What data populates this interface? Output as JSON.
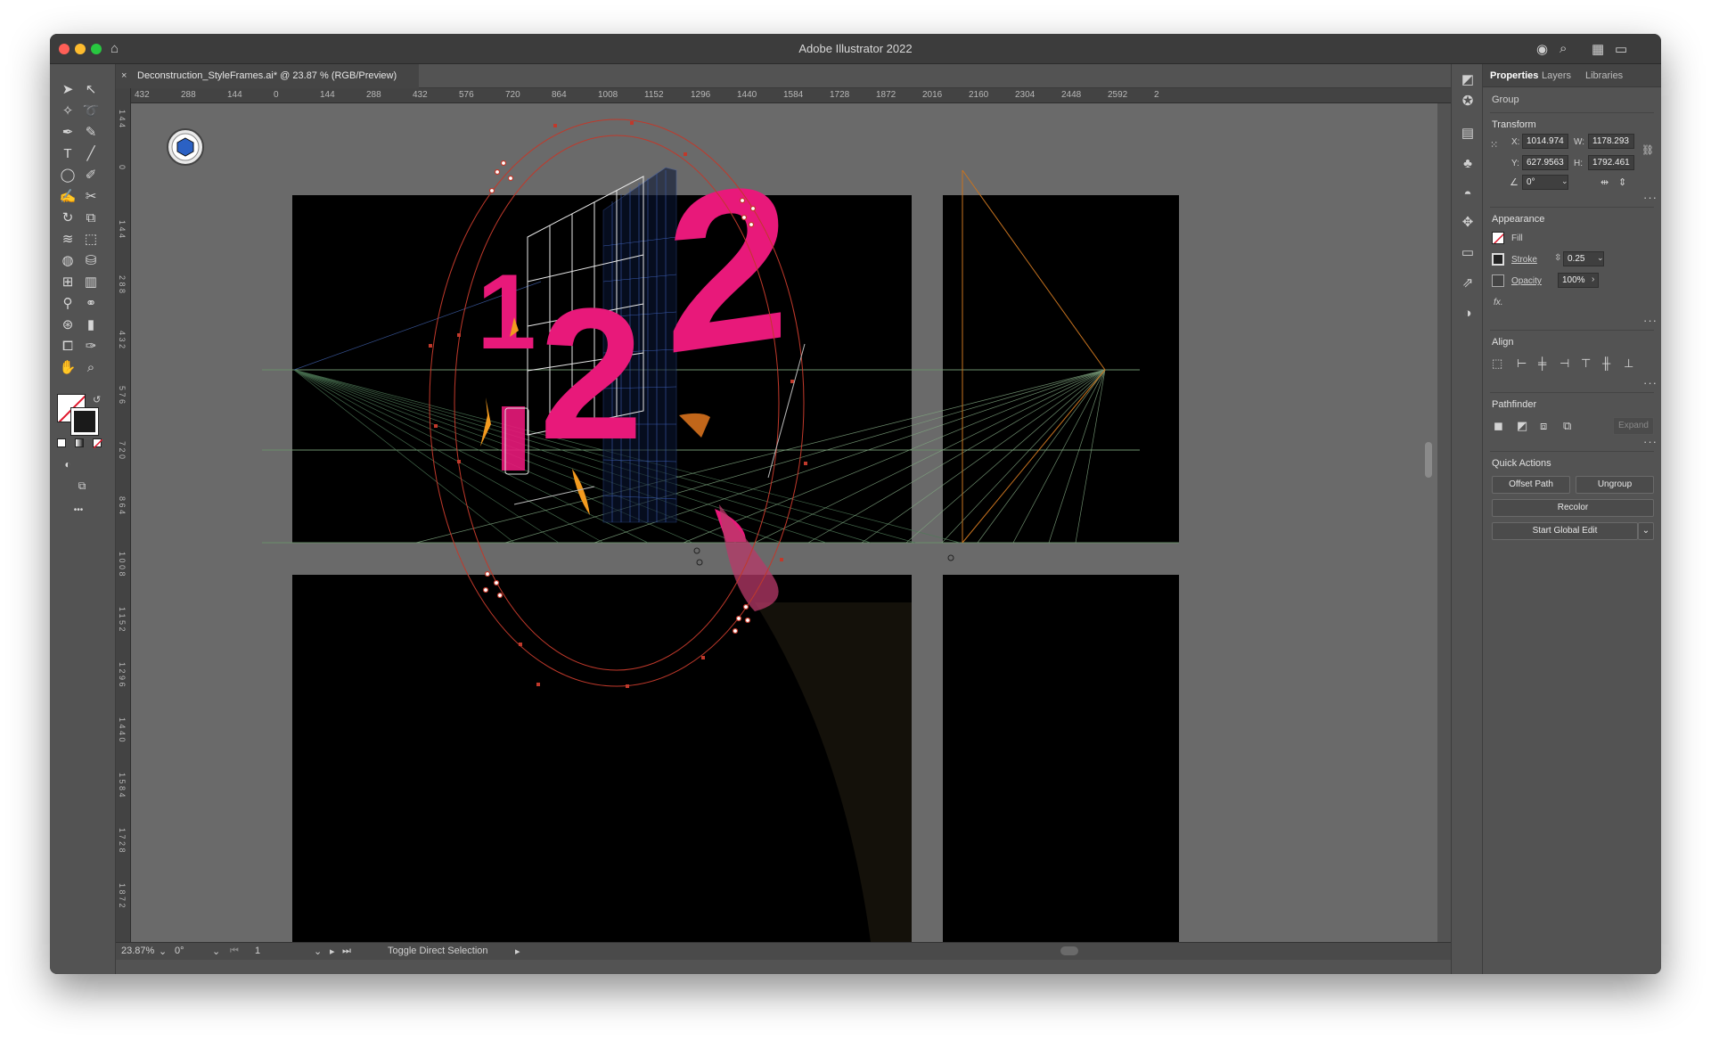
{
  "app": {
    "title": "Adobe Illustrator 2022"
  },
  "document": {
    "tab_title": "Deconstruction_StyleFrames.ai* @ 23.87 % (RGB/Preview)",
    "close_glyph": "×"
  },
  "ruler": {
    "h_ticks": [
      "432",
      "288",
      "144",
      "0",
      "144",
      "288",
      "432",
      "576",
      "720",
      "864",
      "1008",
      "1152",
      "1296",
      "1440",
      "1584",
      "1728",
      "1872",
      "2016",
      "2160",
      "2304",
      "2448",
      "2592",
      "2"
    ],
    "v_ticks": [
      "1 4 4",
      "0",
      "1 4 4",
      "2 8 8",
      "4 3 2",
      "5 7 6",
      "7 2 0",
      "8 6 4",
      "1 0 0 8",
      "1 1 5 2",
      "1 2 9 6",
      "1 4 4 0",
      "1 5 8 4",
      "1 7 2 8",
      "1 8 7 2"
    ]
  },
  "toolbar": {
    "tools": [
      "selection-tool",
      "direct-selection-tool",
      "magic-wand-tool",
      "lasso-tool",
      "pen-tool",
      "curvature-tool",
      "type-tool",
      "line-tool",
      "ellipse-tool",
      "paintbrush-tool",
      "blob-brush-tool",
      "scissors-tool",
      "rotate-tool",
      "scale-tool",
      "warp-tool",
      "free-transform-tool",
      "shape-builder-tool",
      "live-paint-tool",
      "mesh-tool",
      "gradient-tool",
      "eyedropper-tool",
      "blend-tool",
      "symbol-sprayer-tool",
      "column-graph-tool",
      "artboard-tool",
      "slice-tool",
      "hand-tool",
      "zoom-tool"
    ],
    "more_glyph": "•••"
  },
  "status": {
    "zoom": "23.87%",
    "rotation": "0°",
    "artboard": "1",
    "message": "Toggle Direct Selection"
  },
  "panel": {
    "tabs": [
      "Properties",
      "Layers",
      "Libraries"
    ],
    "selection_type": "Group",
    "transform": {
      "title": "Transform",
      "x_label": "X:",
      "x": "1014.974",
      "y_label": "Y:",
      "y": "627.9563",
      "w_label": "W:",
      "w": "1178.293",
      "h_label": "H:",
      "h": "1792.461",
      "angle": "0°"
    },
    "appearance": {
      "title": "Appearance",
      "fill_label": "Fill",
      "stroke_label": "Stroke",
      "stroke_value": "0.25",
      "opacity_label": "Opacity",
      "opacity_value": "100%",
      "fx_label": "fx."
    },
    "align": {
      "title": "Align"
    },
    "pathfinder": {
      "title": "Pathfinder",
      "expand_label": "Expand"
    },
    "quick_actions": {
      "title": "Quick Actions",
      "offset_path": "Offset Path",
      "ungroup": "Ungroup",
      "recolor": "Recolor",
      "start_global_edit": "Start Global Edit"
    }
  },
  "artwork": {
    "digits": [
      "1",
      "2",
      "2"
    ],
    "accent_color": "#e8197a",
    "orange_color": "#f29a1f",
    "selection_color": "#c0392b"
  }
}
